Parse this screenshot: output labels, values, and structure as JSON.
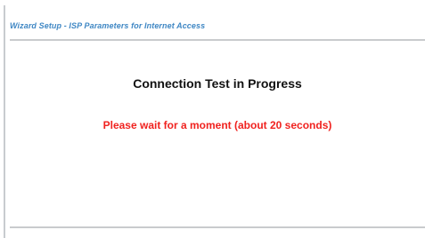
{
  "header": {
    "title": "Wizard Setup - ISP Parameters for Internet Access"
  },
  "main": {
    "heading": "Connection Test in Progress",
    "message": "Please wait for a moment (about 20 seconds)"
  },
  "colors": {
    "header_text": "#3f87c4",
    "message_text": "#f0221f",
    "heading_text": "#111111",
    "rule": "#c9cbcd"
  }
}
